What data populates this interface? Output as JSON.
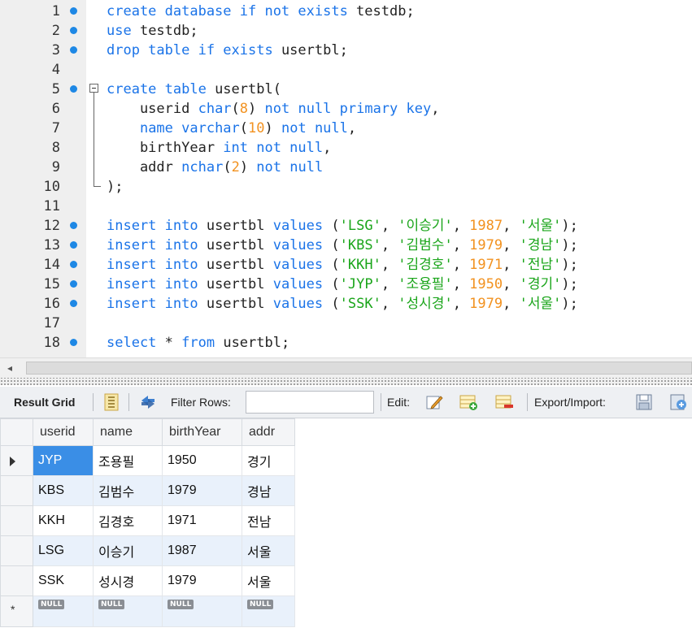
{
  "editor": {
    "lines": [
      {
        "n": "1",
        "bp": true,
        "tokens": [
          [
            "kw",
            "create database if not exists"
          ],
          [
            "op",
            " testdb;"
          ]
        ]
      },
      {
        "n": "2",
        "bp": true,
        "tokens": [
          [
            "kw",
            "use"
          ],
          [
            "op",
            " testdb;"
          ]
        ]
      },
      {
        "n": "3",
        "bp": true,
        "tokens": [
          [
            "kw",
            "drop table if exists"
          ],
          [
            "op",
            " usertbl;"
          ]
        ]
      },
      {
        "n": "4",
        "bp": false,
        "tokens": []
      },
      {
        "n": "5",
        "bp": true,
        "tokens": [
          [
            "kw",
            "create table"
          ],
          [
            "op",
            " usertbl("
          ]
        ]
      },
      {
        "n": "6",
        "bp": false,
        "tokens": [
          [
            "op",
            "    userid "
          ],
          [
            "kw",
            "char"
          ],
          [
            "op",
            "("
          ],
          [
            "num",
            "8"
          ],
          [
            "op",
            ") "
          ],
          [
            "kw",
            "not null primary key"
          ],
          [
            "op",
            ","
          ]
        ]
      },
      {
        "n": "7",
        "bp": false,
        "tokens": [
          [
            "op",
            "    "
          ],
          [
            "kw",
            "name varchar"
          ],
          [
            "op",
            "("
          ],
          [
            "num",
            "10"
          ],
          [
            "op",
            ") "
          ],
          [
            "kw",
            "not null"
          ],
          [
            "op",
            ","
          ]
        ]
      },
      {
        "n": "8",
        "bp": false,
        "tokens": [
          [
            "op",
            "    birthYear "
          ],
          [
            "kw",
            "int not null"
          ],
          [
            "op",
            ","
          ]
        ]
      },
      {
        "n": "9",
        "bp": false,
        "tokens": [
          [
            "op",
            "    addr "
          ],
          [
            "kw",
            "nchar"
          ],
          [
            "op",
            "("
          ],
          [
            "num",
            "2"
          ],
          [
            "op",
            ") "
          ],
          [
            "kw",
            "not null"
          ]
        ]
      },
      {
        "n": "10",
        "bp": false,
        "tokens": [
          [
            "op",
            ");"
          ]
        ]
      },
      {
        "n": "11",
        "bp": false,
        "tokens": []
      },
      {
        "n": "12",
        "bp": true,
        "tokens": [
          [
            "kw",
            "insert into"
          ],
          [
            "op",
            " usertbl "
          ],
          [
            "kw",
            "values"
          ],
          [
            "op",
            " ("
          ],
          [
            "str",
            "'LSG'"
          ],
          [
            "op",
            ", "
          ],
          [
            "str",
            "'이승기'"
          ],
          [
            "op",
            ", "
          ],
          [
            "num",
            "1987"
          ],
          [
            "op",
            ", "
          ],
          [
            "str",
            "'서울'"
          ],
          [
            "op",
            ");"
          ]
        ]
      },
      {
        "n": "13",
        "bp": true,
        "tokens": [
          [
            "kw",
            "insert into"
          ],
          [
            "op",
            " usertbl "
          ],
          [
            "kw",
            "values"
          ],
          [
            "op",
            " ("
          ],
          [
            "str",
            "'KBS'"
          ],
          [
            "op",
            ", "
          ],
          [
            "str",
            "'김범수'"
          ],
          [
            "op",
            ", "
          ],
          [
            "num",
            "1979"
          ],
          [
            "op",
            ", "
          ],
          [
            "str",
            "'경남'"
          ],
          [
            "op",
            ");"
          ]
        ]
      },
      {
        "n": "14",
        "bp": true,
        "tokens": [
          [
            "kw",
            "insert into"
          ],
          [
            "op",
            " usertbl "
          ],
          [
            "kw",
            "values"
          ],
          [
            "op",
            " ("
          ],
          [
            "str",
            "'KKH'"
          ],
          [
            "op",
            ", "
          ],
          [
            "str",
            "'김경호'"
          ],
          [
            "op",
            ", "
          ],
          [
            "num",
            "1971"
          ],
          [
            "op",
            ", "
          ],
          [
            "str",
            "'전남'"
          ],
          [
            "op",
            ");"
          ]
        ]
      },
      {
        "n": "15",
        "bp": true,
        "tokens": [
          [
            "kw",
            "insert into"
          ],
          [
            "op",
            " usertbl "
          ],
          [
            "kw",
            "values"
          ],
          [
            "op",
            " ("
          ],
          [
            "str",
            "'JYP'"
          ],
          [
            "op",
            ", "
          ],
          [
            "str",
            "'조용필'"
          ],
          [
            "op",
            ", "
          ],
          [
            "num",
            "1950"
          ],
          [
            "op",
            ", "
          ],
          [
            "str",
            "'경기'"
          ],
          [
            "op",
            ");"
          ]
        ]
      },
      {
        "n": "16",
        "bp": true,
        "tokens": [
          [
            "kw",
            "insert into"
          ],
          [
            "op",
            " usertbl "
          ],
          [
            "kw",
            "values"
          ],
          [
            "op",
            " ("
          ],
          [
            "str",
            "'SSK'"
          ],
          [
            "op",
            ", "
          ],
          [
            "str",
            "'성시경'"
          ],
          [
            "op",
            ", "
          ],
          [
            "num",
            "1979"
          ],
          [
            "op",
            ", "
          ],
          [
            "str",
            "'서울'"
          ],
          [
            "op",
            ");"
          ]
        ]
      },
      {
        "n": "17",
        "bp": false,
        "tokens": []
      },
      {
        "n": "18",
        "bp": true,
        "tokens": [
          [
            "kw",
            "select"
          ],
          [
            "op",
            " * "
          ],
          [
            "kw",
            "from"
          ],
          [
            "op",
            " usertbl;"
          ]
        ]
      }
    ]
  },
  "scrollbar": {
    "left_arrow": "◂"
  },
  "toolbar": {
    "result_grid_label": "Result Grid",
    "filter_rows_label": "Filter Rows:",
    "filter_value": "",
    "edit_label": "Edit:",
    "export_label": "Export/Import:"
  },
  "grid": {
    "columns": [
      "userid",
      "name",
      "birthYear",
      "addr"
    ],
    "rows": [
      [
        "JYP",
        "조용필",
        "1950",
        "경기"
      ],
      [
        "KBS",
        "김범수",
        "1979",
        "경남"
      ],
      [
        "KKH",
        "김경호",
        "1971",
        "전남"
      ],
      [
        "LSG",
        "이승기",
        "1987",
        "서울"
      ],
      [
        "SSK",
        "성시경",
        "1979",
        "서울"
      ]
    ],
    "null_label": "NULL",
    "new_row_marker": "*"
  },
  "colors": {
    "keyword": "#1a73e8",
    "number": "#f29220",
    "string": "#1aa51a",
    "selected_cell": "#3a8ee6",
    "alt_row": "#e9f1fb"
  }
}
